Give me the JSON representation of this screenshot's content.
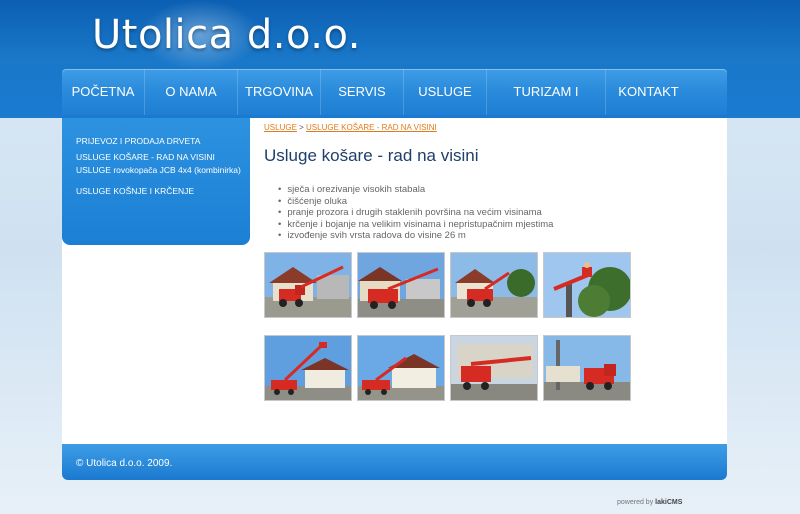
{
  "site": {
    "title": "Utolica d.o.o."
  },
  "nav": {
    "items": [
      {
        "label": "POČETNA"
      },
      {
        "label": "O NAMA"
      },
      {
        "label": "TRGOVINA"
      },
      {
        "label": "SERVIS"
      },
      {
        "label": "USLUGE"
      },
      {
        "label": "TURIZAM I ODMOR"
      },
      {
        "label": "KONTAKT"
      }
    ]
  },
  "sidebar": {
    "items": [
      {
        "label": "PRIJEVOZ I PRODAJA DRVETA"
      },
      {
        "label": "USLUGE KOŠARE - RAD NA VISINI"
      },
      {
        "label": "USLUGE rovokopača JCB 4x4 (kombinirka)"
      },
      {
        "label": "USLUGE KOŠNJE I KRČENJE"
      }
    ]
  },
  "breadcrumb": {
    "parent": "USLUGE",
    "separator": " > ",
    "current": "USLUGE KOŠARE - RAD NA VISINI"
  },
  "content": {
    "title": "Usluge košare - rad na visini",
    "bullets": [
      "sječa i orezivanje visokih stabala",
      "čišćenje oluka",
      "pranje prozora i drugih staklenih površina na većim visinama",
      "krčenje i bojanje na velikim visinama i nepristupačnim mjestima",
      "izvođenje svih vrsta radova do visine 26 m"
    ]
  },
  "gallery": {
    "icon": "truck-crane-photo",
    "count": 8
  },
  "footer": {
    "copyright": "© Utolica d.o.o. 2009.",
    "powered_prefix": "powered by",
    "powered_brand": "lakiCMS"
  },
  "colors": {
    "header_blue": "#1a78c9",
    "nav_blue": "#2a8bdc",
    "link_orange": "#e07b1a",
    "title_navy": "#1f3f6b"
  }
}
